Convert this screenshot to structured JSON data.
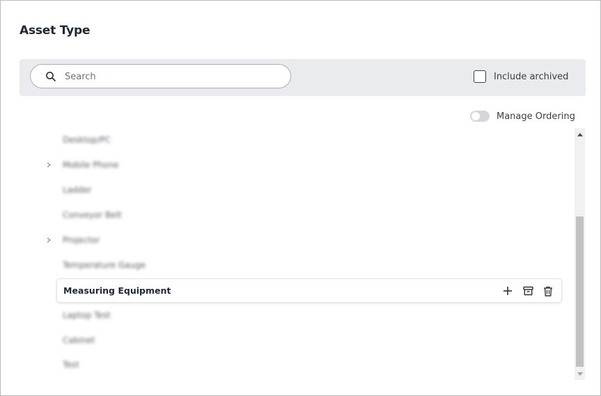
{
  "header": {
    "title": "Asset Type"
  },
  "search": {
    "placeholder": "Search",
    "value": ""
  },
  "filters": {
    "include_archived_label": "Include archived",
    "include_archived_checked": false
  },
  "ordering": {
    "label": "Manage Ordering",
    "enabled": false
  },
  "tree": {
    "items": [
      {
        "label": "Desktop/PC",
        "expandable": false
      },
      {
        "label": "Mobile Phone",
        "expandable": true
      },
      {
        "label": "Ladder",
        "expandable": false
      },
      {
        "label": "Conveyor Belt",
        "expandable": false
      },
      {
        "label": "Projector",
        "expandable": true
      },
      {
        "label": "Temperature Gauge",
        "expandable": false
      },
      {
        "label": "Measuring Equipment",
        "expandable": false,
        "selected": true
      },
      {
        "label": "Laptop Test",
        "expandable": false
      },
      {
        "label": "Cabinet",
        "expandable": false
      },
      {
        "label": "Test",
        "expandable": false
      }
    ],
    "row_actions": [
      "plus-icon",
      "archive-icon",
      "trash-icon"
    ]
  },
  "colors": {
    "toolbar_bg": "#e9ebee",
    "text": "#1f2733",
    "scroll_thumb": "#c1c1c1"
  }
}
